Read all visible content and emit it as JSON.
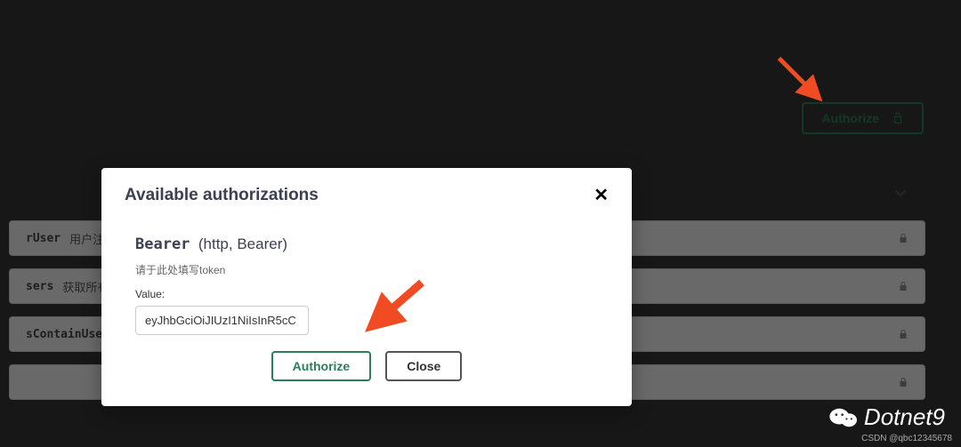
{
  "top": {
    "authorize_label": "Authorize"
  },
  "endpoints": [
    {
      "name": "rUser",
      "desc": "用户注册"
    },
    {
      "name": "sers",
      "desc": "获取所有的用"
    },
    {
      "name": "sContainUserR",
      "desc": ""
    },
    {
      "name": "",
      "desc": ""
    }
  ],
  "modal": {
    "title": "Available authorizations",
    "scheme_name": "Bearer",
    "scheme_type": "(http, Bearer)",
    "scheme_desc": "请于此处填写token",
    "value_label": "Value:",
    "value": "eyJhbGciOiJIUzI1NiIsInR5cC",
    "authorize_label": "Authorize",
    "close_label": "Close"
  },
  "watermark": {
    "brand": "Dotnet9",
    "footer": "CSDN @qbc12345678"
  },
  "colors": {
    "accent": "#2E7D5A",
    "arrow": "#F04B23"
  }
}
